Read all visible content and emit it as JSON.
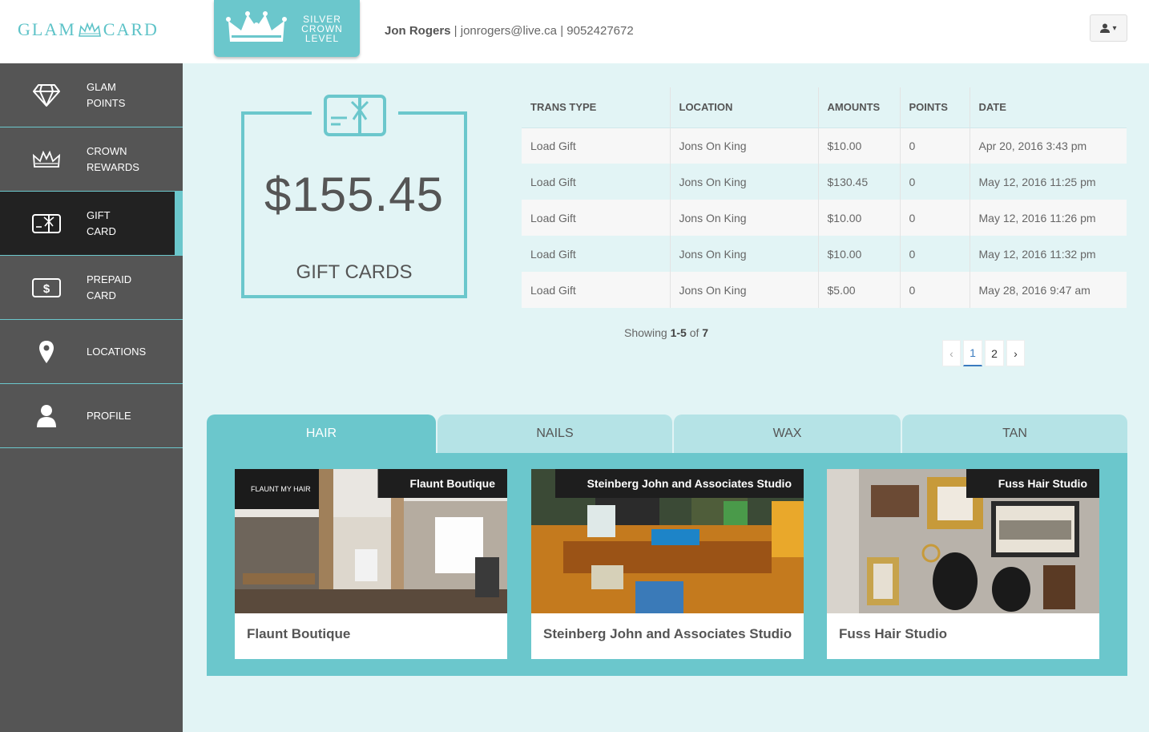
{
  "header": {
    "logo_left": "GLAM",
    "logo_right": "CARD",
    "level_badge": {
      "line1": "SILVER",
      "line2": "CROWN",
      "line3": "LEVEL"
    },
    "user": {
      "name": "Jon Rogers",
      "separator": " | ",
      "email": "jonrogers@live.ca",
      "phone": "9052427672"
    },
    "user_menu_caret": "▾"
  },
  "sidebar": {
    "items": [
      {
        "label_1": "GLAM",
        "label_2": "POINTS",
        "icon": "diamond-icon"
      },
      {
        "label_1": "CROWN",
        "label_2": "REWARDS",
        "icon": "crown-icon"
      },
      {
        "label_1": "GIFT",
        "label_2": "CARD",
        "icon": "gift-card-icon",
        "active": true
      },
      {
        "label_1": "PREPAID",
        "label_2": "CARD",
        "icon": "dollar-card-icon"
      },
      {
        "label_1": "LOCATIONS",
        "label_2": "",
        "icon": "map-pin-icon"
      },
      {
        "label_1": "PROFILE",
        "label_2": "",
        "icon": "user-icon"
      }
    ]
  },
  "gift_summary": {
    "amount": "$155.45",
    "label": "GIFT CARDS"
  },
  "transactions": {
    "columns": [
      "TRANS TYPE",
      "LOCATION",
      "AMOUNTS",
      "POINTS",
      "DATE"
    ],
    "rows": [
      [
        "Load Gift",
        "Jons On King",
        "$10.00",
        "0",
        "Apr 20, 2016 3:43 pm"
      ],
      [
        "Load Gift",
        "Jons On King",
        "$130.45",
        "0",
        "May 12, 2016 11:25 pm"
      ],
      [
        "Load Gift",
        "Jons On King",
        "$10.00",
        "0",
        "May 12, 2016 11:26 pm"
      ],
      [
        "Load Gift",
        "Jons On King",
        "$10.00",
        "0",
        "May 12, 2016 11:32 pm"
      ],
      [
        "Load Gift",
        "Jons On King",
        "$5.00",
        "0",
        "May 28, 2016 9:47 am"
      ]
    ],
    "showing_prefix": "Showing ",
    "showing_range": "1-5",
    "showing_mid": " of ",
    "showing_total": "7",
    "pagination": {
      "prev": "‹",
      "pages": [
        "1",
        "2"
      ],
      "current": "1",
      "next": "›"
    }
  },
  "service_tabs": {
    "tabs": [
      "HAIR",
      "NAILS",
      "WAX",
      "TAN"
    ],
    "active": "HAIR",
    "cards": [
      {
        "tag": "Flaunt Boutique",
        "title": "Flaunt Boutique",
        "photo_text": "FLAUNT MY HAIR"
      },
      {
        "tag": "Steinberg John and Associates Studio",
        "title": "Steinberg John and Associates Studio"
      },
      {
        "tag": "Fuss Hair Studio",
        "title": "Fuss Hair Studio"
      }
    ]
  },
  "colors": {
    "accent": "#6bc7cc",
    "sidebar_bg": "#555555",
    "sidebar_active": "#222222",
    "page_bg": "#e2f4f5"
  }
}
